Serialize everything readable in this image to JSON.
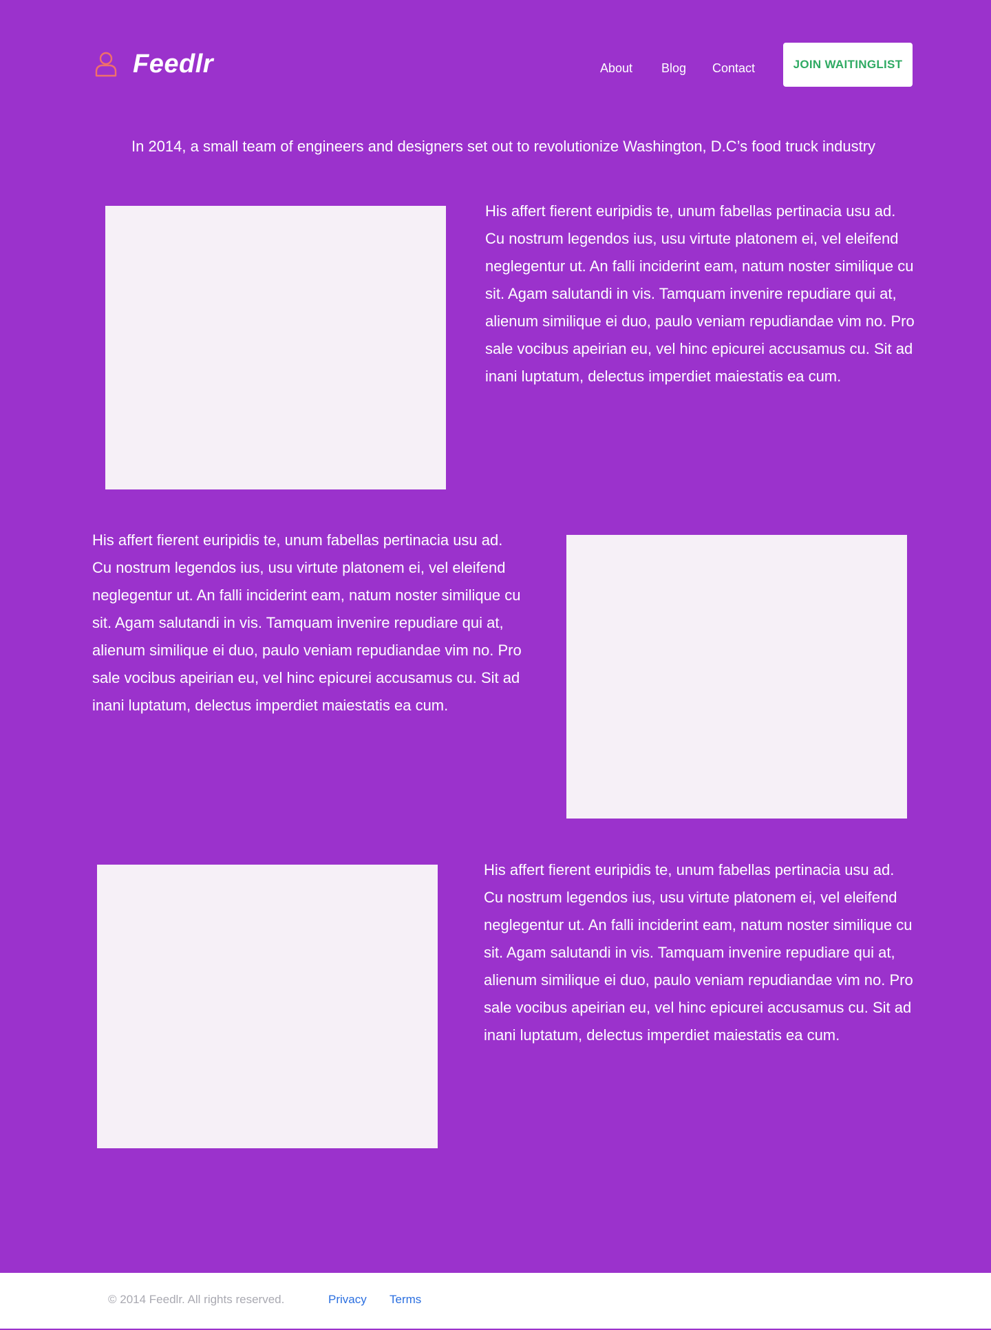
{
  "header": {
    "brand_name": "Feedlr",
    "brand_icon": "user-icon",
    "nav": [
      {
        "label": "About"
      },
      {
        "label": "Blog"
      },
      {
        "label": "Contact"
      }
    ],
    "cta_label": "JOIN WAITINGLIST"
  },
  "main": {
    "intro": "In 2014, a small team of engineers and designers set out to revolutionize Washington, D.C’s food truck industry",
    "sections": [
      {
        "text": "His affert fierent euripidis te, unum fabellas pertinacia usu ad. Cu nostrum legendos ius, usu virtute platonem ei, vel eleifend neglegentur ut. An falli inciderint eam, natum noster similique cu sit. Agam salutandi in vis. Tamquam invenire repudiare qui at, alienum similique ei duo, paulo veniam repudiandae vim no. Pro sale vocibus apeirian eu, vel hinc epicurei accusamus cu. Sit ad inani luptatum, delectus imperdiet maiestatis ea cum."
      },
      {
        "text": "His affert fierent euripidis te, unum fabellas pertinacia usu ad. Cu nostrum legendos ius, usu virtute platonem ei, vel eleifend neglegentur ut. An falli inciderint eam, natum noster similique cu sit. Agam salutandi in vis. Tamquam invenire repudiare qui at, alienum similique ei duo, paulo veniam repudiandae vim no. Pro sale vocibus apeirian eu, vel hinc epicurei accusamus cu. Sit ad inani luptatum, delectus imperdiet maiestatis ea cum."
      },
      {
        "text": "His affert fierent euripidis te, unum fabellas pertinacia usu ad. Cu nostrum legendos ius, usu virtute platonem ei, vel eleifend neglegentur ut. An falli inciderint eam, natum noster similique cu sit. Agam salutandi in vis. Tamquam invenire repudiare qui at, alienum similique ei duo, paulo veniam repudiandae vim no. Pro sale vocibus apeirian eu, vel hinc epicurei accusamus cu. Sit ad inani luptatum, delectus imperdiet maiestatis ea cum."
      }
    ]
  },
  "footer": {
    "copyright": "© 2014 Feedlr. All rights reserved.",
    "links": [
      {
        "label": "Privacy"
      },
      {
        "label": "Terms"
      }
    ]
  },
  "colors": {
    "background": "#9b32cc",
    "logo_icon": "#f0706a",
    "cta_text": "#2faa63",
    "footer_link": "#2b6fe0",
    "image_placeholder": "#f6f0f7"
  }
}
